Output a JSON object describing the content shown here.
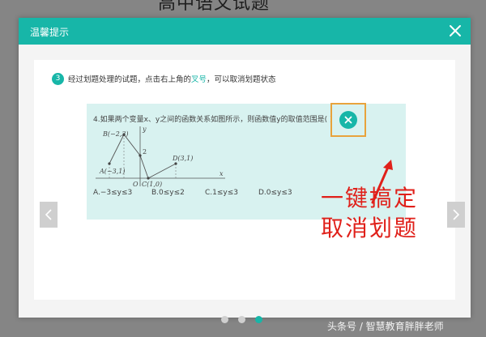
{
  "background": {
    "title_fragment": "高中语文试题"
  },
  "modal": {
    "title": "温馨提示",
    "step": {
      "number": "3",
      "text_before": "经过划题处理的试题，点击右上角的",
      "highlight": "叉号",
      "text_after": "，可以取消划题状态"
    },
    "question": {
      "text": "4.如果两个变量x、y之间的函数关系如图所示，则函数值y的取值范围是(    )",
      "graph_labels": {
        "y_axis": "y",
        "x_axis": "x",
        "origin": "O",
        "point_a": "A(−3,1)",
        "point_b": "B(−2,3)",
        "point_c": "C(1,0)",
        "point_d": "D(3,1)",
        "y_mark": "2"
      },
      "options": [
        "A.−3≤y≤3",
        "B.0≤y≤2",
        "C.1≤y≤3",
        "D.0≤y≤3"
      ]
    },
    "callout": {
      "line1": "一键搞定",
      "line2": "取消划题"
    },
    "pagination": {
      "total": 3,
      "active": 3
    }
  },
  "watermark": "头条号 / 智慧教育胖胖老师",
  "colors": {
    "accent": "#17b6a8",
    "highlight_frame": "#e8a33c",
    "callout": "#e0201a"
  },
  "icons": {
    "close": "close-icon",
    "remove_strike": "x-circle-icon",
    "prev": "chevron-left-icon",
    "next": "chevron-right-icon"
  }
}
